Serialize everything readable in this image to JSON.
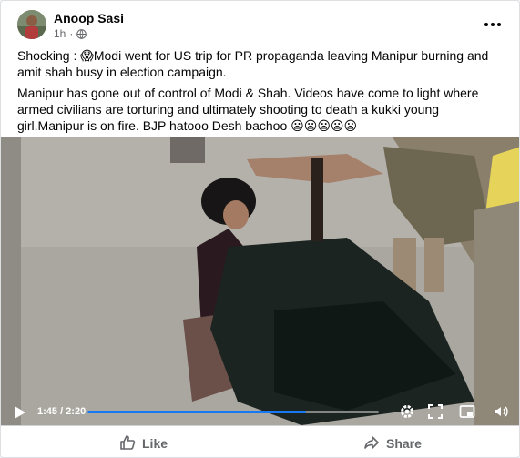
{
  "post": {
    "author": "Anoop Sasi",
    "time": "1h",
    "paragraph1": "Shocking : 😱Modi went for US trip for PR propaganda leaving Manipur burning and amit shah busy in election campaign.",
    "paragraph2": "Manipur has gone out of control of Modi & Shah. Videos have come to light where armed civilians are torturing and ultimately shooting to death a kukki  young girl.Manipur is on fire. BJP hatooo Desh bachoo  😦😦😦😦😦"
  },
  "video": {
    "time_display": "1:45 / 2:20",
    "progress": 0.75,
    "accent_color": "#1877f2"
  },
  "actions": {
    "like_label": "Like",
    "share_label": "Share"
  },
  "icons": [
    "globe-icon",
    "more-options-icon",
    "play-icon",
    "settings-icon",
    "fullscreen-icon",
    "pip-icon",
    "volume-icon",
    "like-icon",
    "share-icon"
  ]
}
